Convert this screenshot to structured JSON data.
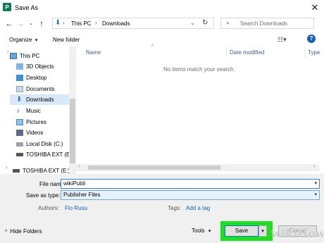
{
  "window": {
    "title": "Save As",
    "app_icon": "P"
  },
  "nav": {
    "crumbs": [
      "This PC",
      "Downloads"
    ],
    "search_placeholder": "Search Downloads"
  },
  "toolbar": {
    "organize": "Organize",
    "new_folder": "New folder"
  },
  "sidebar": {
    "items": [
      {
        "label": "This PC",
        "icon": "computer-icon"
      },
      {
        "label": "3D Objects",
        "icon": "cube-folder-icon"
      },
      {
        "label": "Desktop",
        "icon": "desktop-folder-icon"
      },
      {
        "label": "Documents",
        "icon": "documents-folder-icon"
      },
      {
        "label": "Downloads",
        "icon": "download-arrow-icon",
        "selected": true
      },
      {
        "label": "Music",
        "icon": "music-note-icon"
      },
      {
        "label": "Pictures",
        "icon": "pictures-folder-icon"
      },
      {
        "label": "Videos",
        "icon": "videos-folder-icon"
      },
      {
        "label": "Local Disk (C:)",
        "icon": "drive-icon"
      },
      {
        "label": "TOSHIBA EXT (E:",
        "icon": "usb-drive-icon"
      },
      {
        "label": "TOSHIBA EXT (E:)",
        "icon": "usb-drive-icon"
      }
    ]
  },
  "columns": [
    "Name",
    "Date modified",
    "Type"
  ],
  "empty_message": "No items match your search.",
  "form": {
    "file_name_label": "File name:",
    "file_name_value": "wikiPubli",
    "save_type_label": "Save as type:",
    "save_type_value": "Publisher Files",
    "authors_label": "Authors:",
    "authors_value": "Flo Rusu",
    "tags_label": "Tags:",
    "tags_value": "Add a tag"
  },
  "footer": {
    "hide_folders": "Hide Folders",
    "tools": "Tools",
    "save": "Save",
    "cancel": "Cancel"
  },
  "watermark": "wikiHow",
  "colors": {
    "highlight": "#1ee01e",
    "selection": "#d9e8f7",
    "link": "#1a5fb4"
  }
}
